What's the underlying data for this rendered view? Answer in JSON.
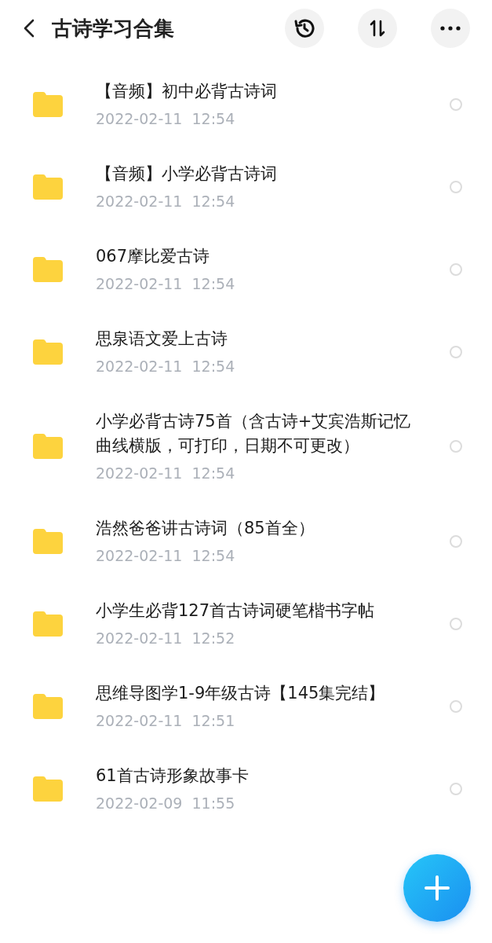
{
  "header": {
    "title": "古诗学习合集"
  },
  "items": [
    {
      "name": "【音频】初中必背古诗词",
      "date": "2022-02-11  12:54",
      "selected": false
    },
    {
      "name": "【音频】小学必背古诗词",
      "date": "2022-02-11  12:54",
      "selected": false
    },
    {
      "name": "067摩比爱古诗",
      "date": "2022-02-11  12:54",
      "selected": false
    },
    {
      "name": "思泉语文爱上古诗",
      "date": "2022-02-11  12:54",
      "selected": false
    },
    {
      "name": "小学必背古诗75首（含古诗+艾宾浩斯记忆曲线横版，可打印，日期不可更改）",
      "date": "2022-02-11  12:54",
      "selected": false
    },
    {
      "name": "浩然爸爸讲古诗词（85首全）",
      "date": "2022-02-11  12:54",
      "selected": false
    },
    {
      "name": "小学生必背127首古诗词硬笔楷书字帖",
      "date": "2022-02-11  12:52",
      "selected": false
    },
    {
      "name": "思维导图学1-9年级古诗【145集完结】",
      "date": "2022-02-11  12:51",
      "selected": false
    },
    {
      "name": "61首古诗形象故事卡",
      "date": "2022-02-09  11:55",
      "selected": false
    }
  ]
}
